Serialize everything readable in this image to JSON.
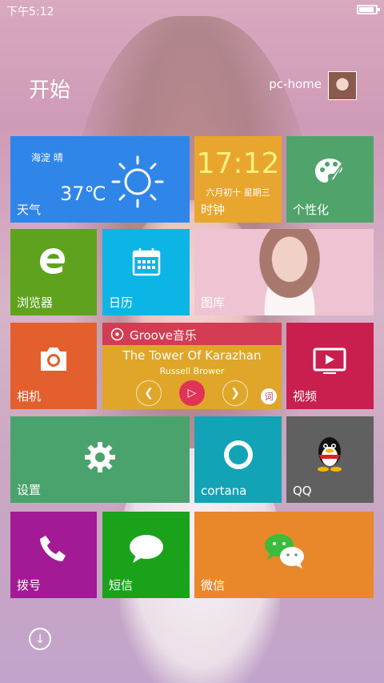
{
  "status": {
    "time": "下午5:12"
  },
  "header": {
    "title": "开始",
    "username": "pc-home"
  },
  "tiles": {
    "weather": {
      "location": "海淀  晴",
      "temperature": "37℃",
      "label": "天气"
    },
    "clock": {
      "time": "17:12",
      "date": "六月初十  星期三",
      "label": "时钟"
    },
    "personalize": {
      "label": "个性化"
    },
    "browser": {
      "label": "浏览器"
    },
    "calendar": {
      "label": "日历"
    },
    "gallery": {
      "label": "图库"
    },
    "camera": {
      "label": "相机"
    },
    "music": {
      "app": "Groove音乐",
      "title": "The Tower Of Karazhan",
      "artist": "Russell Brower",
      "lyric_button": "词"
    },
    "video": {
      "label": "视频"
    },
    "settings": {
      "label": "设置"
    },
    "cortana": {
      "label": "cortana"
    },
    "qq": {
      "label": "QQ"
    },
    "dial": {
      "label": "拨号"
    },
    "sms": {
      "label": "短信"
    },
    "wechat": {
      "label": "微信"
    }
  },
  "icons": {
    "battery": "battery-icon",
    "weather": "sun-icon",
    "personalize": "palette-icon",
    "browser": "edge-icon",
    "calendar": "calendar-icon",
    "camera": "camera-icon",
    "video": "video-play-icon",
    "settings": "gear-icon",
    "cortana": "cortana-ring-icon",
    "qq": "qq-penguin-icon",
    "dial": "phone-icon",
    "sms": "chat-bubble-icon",
    "wechat": "wechat-icon",
    "all_apps": "arrow-down-circle-icon"
  },
  "colors": {
    "weather": "#2f86e8",
    "clock": "#e8a62e",
    "personalize": "#4fa36b",
    "browser": "#5ea21e",
    "calendar": "#0db4e6",
    "camera": "#e35f2d",
    "music": "#dfa629",
    "music_header": "#d33c52",
    "video": "#c81f4e",
    "settings": "#4aa26c",
    "cortana": "#12a3b6",
    "qq": "#606060",
    "dial": "#a21a94",
    "sms": "#1aa21a",
    "wechat": "#e9882a",
    "clock_text": "#fff07a"
  }
}
